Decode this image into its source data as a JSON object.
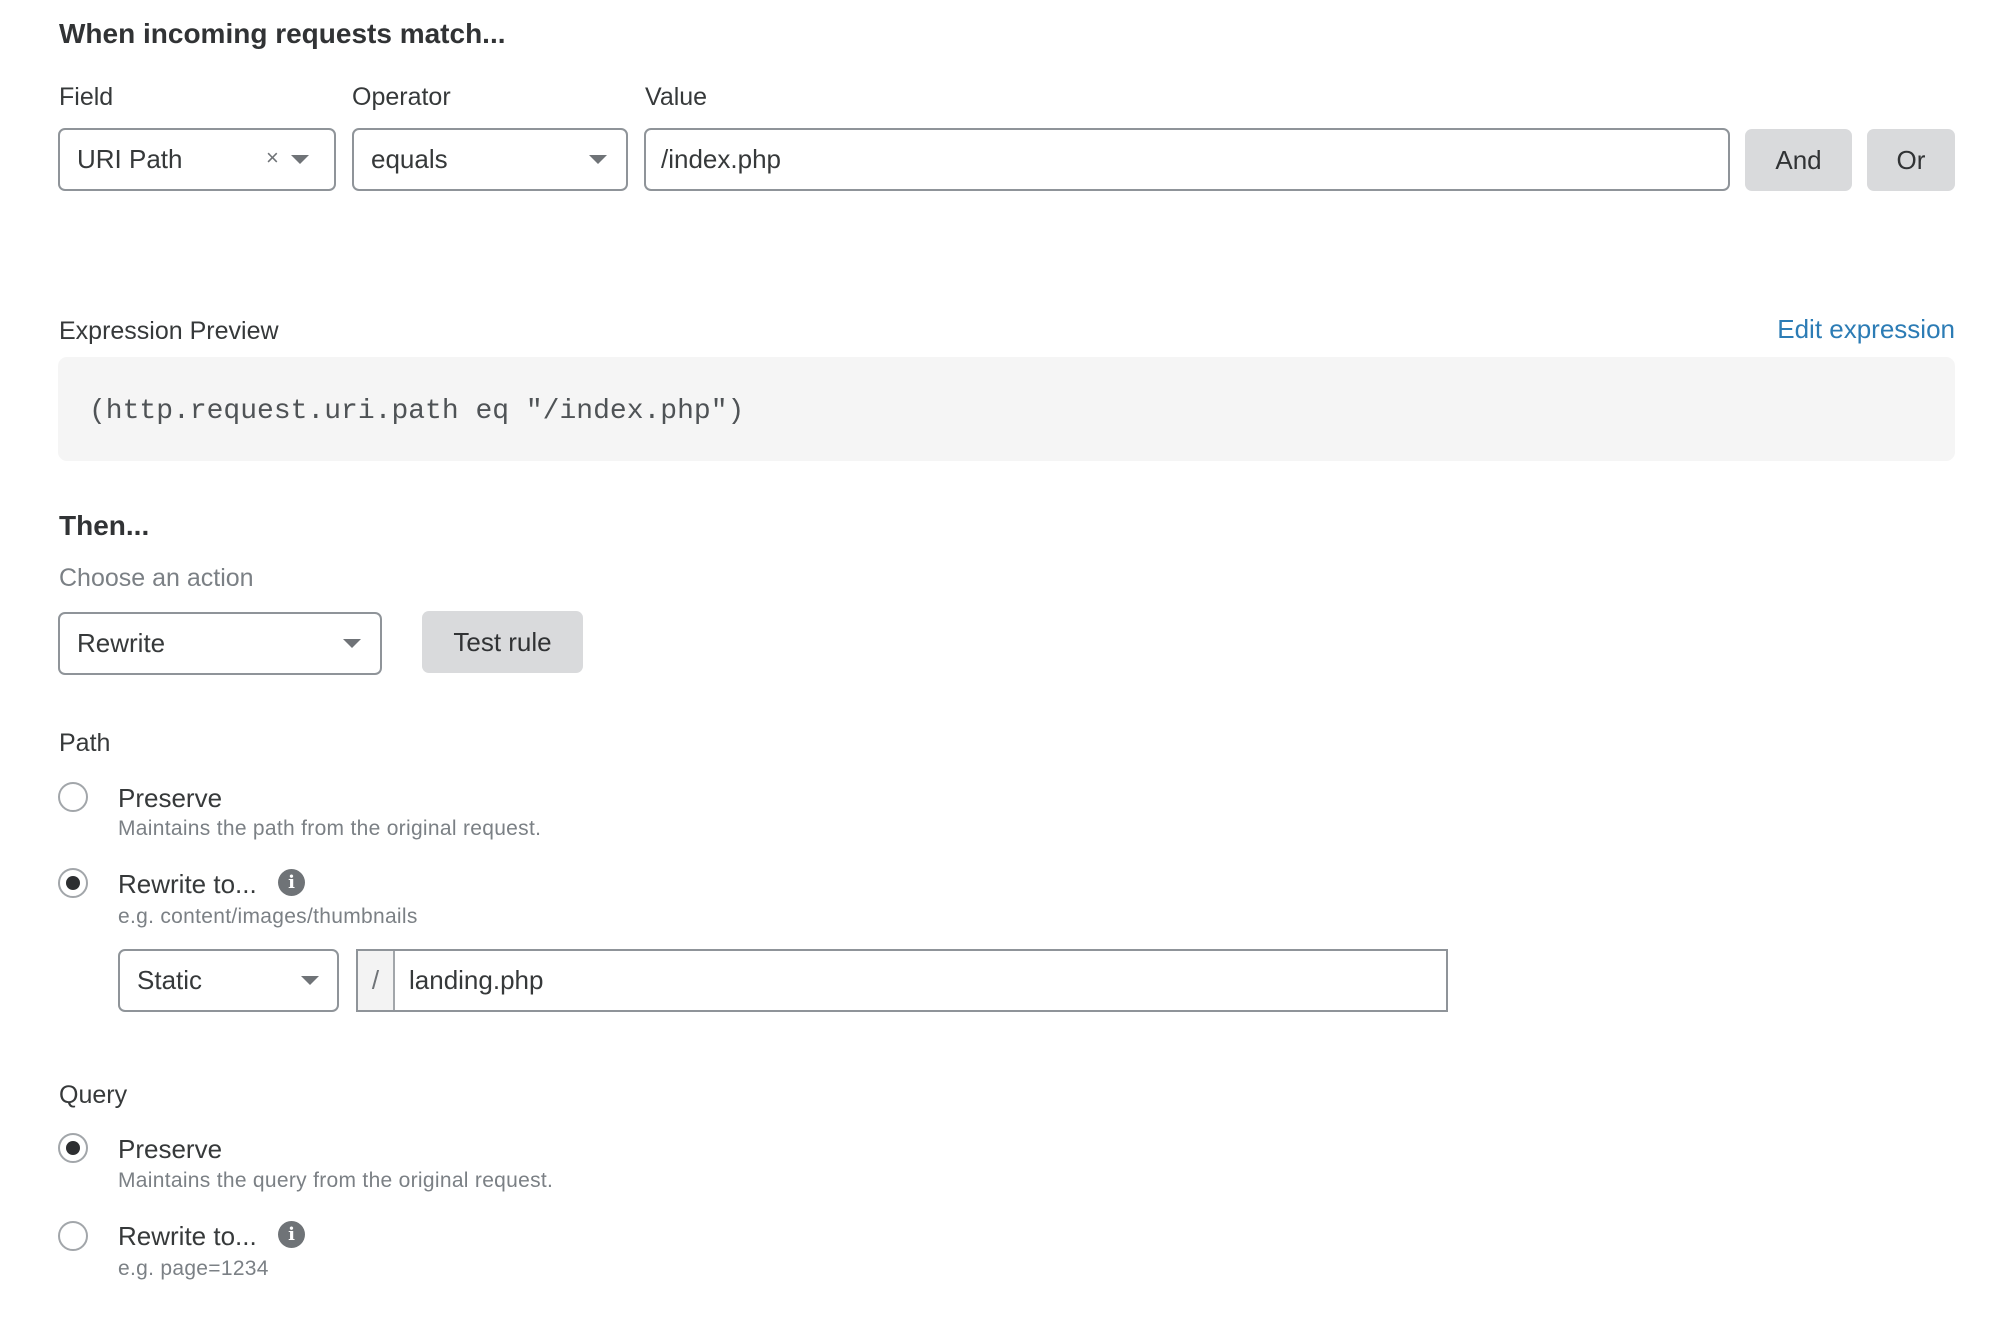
{
  "match": {
    "heading": "When incoming requests match...",
    "field_label": "Field",
    "operator_label": "Operator",
    "value_label": "Value",
    "field_value": "URI Path",
    "field_clear_glyph": "×",
    "operator_value": "equals",
    "value_input": "/index.php",
    "and_button": "And",
    "or_button": "Or"
  },
  "expression": {
    "label": "Expression Preview",
    "edit_link": "Edit expression",
    "code": "(http.request.uri.path eq \"/index.php\")"
  },
  "then": {
    "heading": "Then...",
    "choose_label": "Choose an action",
    "action_value": "Rewrite",
    "test_button": "Test rule"
  },
  "path": {
    "label": "Path",
    "options": [
      {
        "label": "Preserve",
        "description": "Maintains the path from the original request.",
        "checked": false
      },
      {
        "label": "Rewrite to...",
        "description": "e.g. content/images/thumbnails",
        "checked": true,
        "info_icon": "i"
      }
    ],
    "rewrite_type": "Static",
    "rewrite_prefix": "/",
    "rewrite_value": "landing.php"
  },
  "query": {
    "label": "Query",
    "options": [
      {
        "label": "Preserve",
        "description": "Maintains the query from the original request.",
        "checked": true
      },
      {
        "label": "Rewrite to...",
        "description": "e.g. page=1234",
        "checked": false,
        "info_icon": "i"
      }
    ]
  },
  "colors": {
    "link": "#2c7cb5",
    "button_bg": "#d9dadc",
    "code_bg": "#f5f5f5",
    "border": "#8f9499"
  }
}
